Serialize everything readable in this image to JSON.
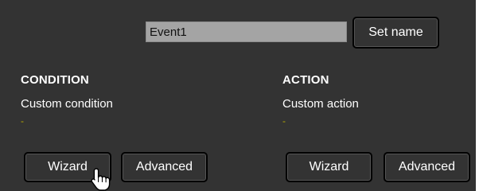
{
  "event": {
    "name_value": "Event1",
    "set_name_label": "Set name"
  },
  "condition": {
    "heading": "CONDITION",
    "description": "Custom condition",
    "value": "-",
    "wizard_label": "Wizard",
    "advanced_label": "Advanced"
  },
  "action": {
    "heading": "ACTION",
    "description": "Custom action",
    "value": "-",
    "wizard_label": "Wizard",
    "advanced_label": "Advanced"
  },
  "colors": {
    "panel_bg": "#333333",
    "input_bg": "#a4a4a4",
    "placeholder_dash": "#b7a800"
  },
  "cursor": {
    "icon": "hand-pointer-icon"
  }
}
